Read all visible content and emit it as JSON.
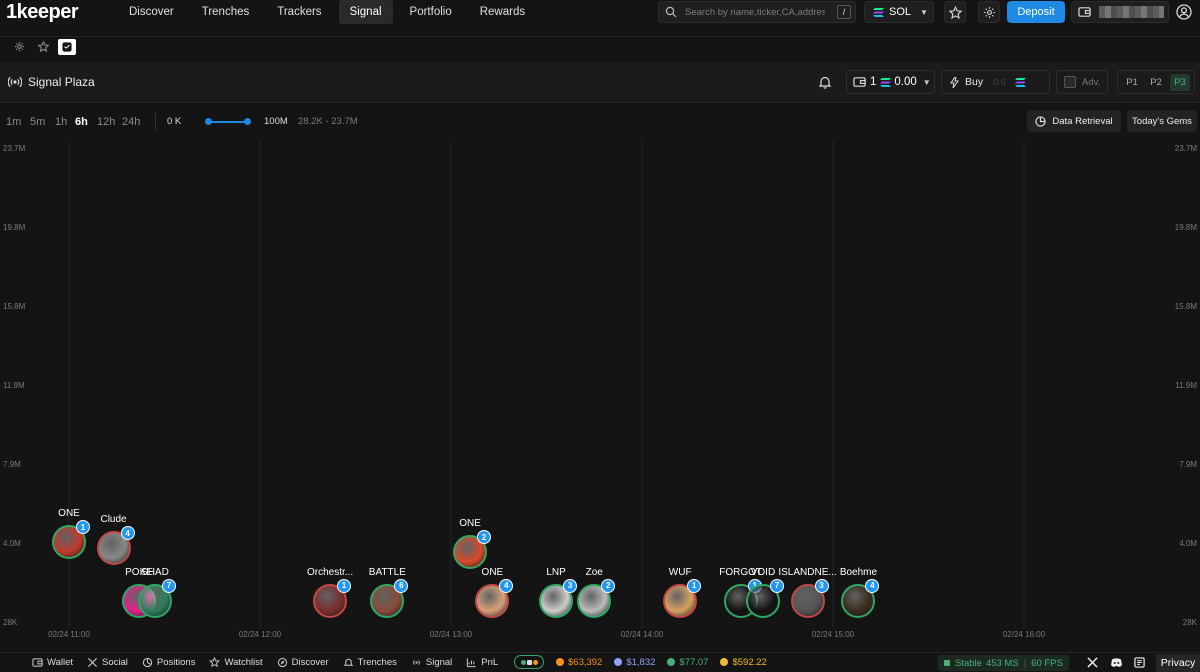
{
  "brand": {
    "logo": "1keeper"
  },
  "nav": [
    {
      "label": "Discover",
      "active": false
    },
    {
      "label": "Trenches",
      "active": false
    },
    {
      "label": "Trackers",
      "active": false
    },
    {
      "label": "Signal",
      "active": true
    },
    {
      "label": "Portfolio",
      "active": false
    },
    {
      "label": "Rewards",
      "active": false
    }
  ],
  "search": {
    "placeholder": "Search by name,ticker,CA,address",
    "shortcut": "/"
  },
  "chain": {
    "label": "SOL"
  },
  "header_actions": {
    "deposit": "Deposit"
  },
  "plaza": {
    "title": "Signal Plaza",
    "wallet_count": "1",
    "wallet_balance": "0.00",
    "buy_label": "Buy",
    "buy_amount": "0.0",
    "adv_label": "Adv.",
    "presets": [
      "P1",
      "P2",
      "P3"
    ],
    "active_preset": "P3"
  },
  "filters": {
    "timeframes": [
      "1m",
      "5m",
      "1h",
      "6h",
      "12h",
      "24h"
    ],
    "active_timeframe": "6h",
    "mc_min": "0 K",
    "mc_max": "100M",
    "mc_range": "28.2K - 23.7M",
    "data_retrieval": "Data Retrieval",
    "todays_gems": "Today's Gems"
  },
  "chart_data": {
    "type": "scatter",
    "y_ticks": [
      "23.7M",
      "19.8M",
      "15.8M",
      "11.9M",
      "7.9M",
      "4.0M",
      "28K"
    ],
    "x_ticks": [
      "02/24 11:00",
      "02/24 12:00",
      "02/24 13:00",
      "02/24 14:00",
      "02/24 15:00",
      "02/24 16:00"
    ],
    "points": [
      {
        "label": "ONE",
        "time": "02/24 11:00",
        "mc": 4.0,
        "badge": "1",
        "color": "#c0392b"
      },
      {
        "label": "Clude",
        "time": "02/24 11:14",
        "mc": 3.7,
        "badge": "4",
        "color": "#888888"
      },
      {
        "label": "POKE",
        "time": "02/24 11:22",
        "mc": 1.1,
        "badge": "",
        "color": "#e91e8c"
      },
      {
        "label": "SHAD",
        "time": "02/24 11:27",
        "mc": 1.1,
        "badge": "7",
        "color": "#2e7d5b"
      },
      {
        "label": "Orchestr...",
        "time": "02/24 12:22",
        "mc": 1.1,
        "badge": "1",
        "color": "#7a2e2e"
      },
      {
        "label": "BATTLE",
        "time": "02/24 12:40",
        "mc": 1.1,
        "badge": "6",
        "color": "#8a4a3a"
      },
      {
        "label": "ONE",
        "time": "02/24 13:06",
        "mc": 3.5,
        "badge": "2",
        "color": "#d84a2a"
      },
      {
        "label": "ONE",
        "time": "02/24 13:13",
        "mc": 1.1,
        "badge": "4",
        "color": "#d8a07a"
      },
      {
        "label": "LNP",
        "time": "02/24 13:33",
        "mc": 1.1,
        "badge": "3",
        "color": "#cccccc"
      },
      {
        "label": "Zoe",
        "time": "02/24 13:45",
        "mc": 1.1,
        "badge": "2",
        "color": "#bbbbbb"
      },
      {
        "label": "WUF",
        "time": "02/24 14:12",
        "mc": 1.1,
        "badge": "1",
        "color": "#d8a060"
      },
      {
        "label": "FORGOT",
        "time": "02/24 14:31",
        "mc": 1.1,
        "badge": "1",
        "color": "#111111"
      },
      {
        "label": "VOID",
        "time": "02/24 14:38",
        "mc": 1.1,
        "badge": "7",
        "color": "#111111"
      },
      {
        "label": "ISLANDNE...",
        "time": "02/24 14:52",
        "mc": 1.1,
        "badge": "3",
        "color": "#555555"
      },
      {
        "label": "Boehme",
        "time": "02/24 15:08",
        "mc": 1.1,
        "badge": "4",
        "color": "#3a2a1a"
      }
    ]
  },
  "bottom": {
    "items": [
      "Wallet",
      "Social",
      "Positions",
      "Watchlist",
      "Discover",
      "Trenches",
      "Signal",
      "PnL"
    ],
    "prices": [
      {
        "symbol": "btc",
        "value": "$63,392",
        "color": "#f7931a"
      },
      {
        "symbol": "eth",
        "value": "$1,832",
        "color": "#8ea2f5"
      },
      {
        "symbol": "sol",
        "value": "$77.07",
        "color": "#4caf7a"
      },
      {
        "symbol": "bnb",
        "value": "$592.22",
        "color": "#f3ba2f"
      }
    ],
    "status": "Stable",
    "latency": "453 MS",
    "fps": "60 FPS",
    "privacy": "Privacy"
  }
}
